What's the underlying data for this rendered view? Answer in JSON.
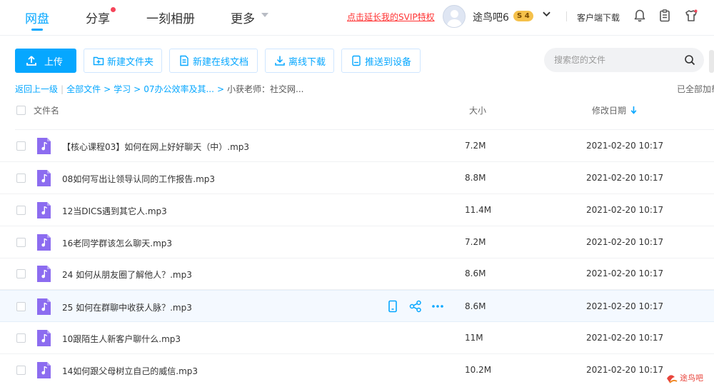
{
  "nav": {
    "tabs": [
      {
        "label": "网盘",
        "active": true
      },
      {
        "label": "分享",
        "badge_dot": true
      },
      {
        "label": "一刻相册"
      },
      {
        "label": "更多"
      }
    ],
    "svip_link": "点击延长我的SVIP特权",
    "username": "途鸟吧6",
    "vip_level": "4",
    "client_download": "客户端下载",
    "icons": [
      "notification-bell-icon",
      "clipboard-icon",
      "shirt-skin-icon"
    ]
  },
  "toolbar": {
    "upload": "上传",
    "new_folder": "新建文件夹",
    "new_online_doc": "新建在线文档",
    "offline_download": "离线下载",
    "push_to_device": "推送到设备",
    "search_placeholder": "搜索您的文件"
  },
  "breadcrumb": {
    "back": "返回上一级",
    "items": [
      "全部文件",
      "学习",
      "07办公效率及其..."
    ],
    "current": "小获老师：社交网...",
    "loaded_all": "已全部加载"
  },
  "table": {
    "headers": {
      "name": "文件名",
      "size": "大小",
      "modified": "修改日期"
    },
    "sort": "modified-desc",
    "rows": [
      {
        "name": "【核心课程03】如何在网上好好聊天（中）.mp3",
        "size": "7.2M",
        "modified": "2021-02-20 10:17"
      },
      {
        "name": "08如何写出让领导认同的工作报告.mp3",
        "size": "8.8M",
        "modified": "2021-02-20 10:17"
      },
      {
        "name": "12当DICS遇到其它人.mp3",
        "size": "11.4M",
        "modified": "2021-02-20 10:17"
      },
      {
        "name": "16老同学群该怎么聊天.mp3",
        "size": "7.2M",
        "modified": "2021-02-20 10:17"
      },
      {
        "name": "24 如何从朋友圈了解他人？.mp3",
        "size": "8.6M",
        "modified": "2021-02-20 10:17"
      },
      {
        "name": "25 如何在群聊中收获人脉？.mp3",
        "size": "8.6M",
        "modified": "2021-02-20 10:17",
        "hovered": true
      },
      {
        "name": "10跟陌生人新客户聊什么.mp3",
        "size": "11M",
        "modified": "2021-02-20 10:17"
      },
      {
        "name": "14如何跟父母树立自己的威信.mp3",
        "size": "10.2M",
        "modified": "2021-02-20 10:17"
      }
    ],
    "hover_actions": [
      "phone-icon",
      "share-icon",
      "more-icon"
    ]
  },
  "colors": {
    "accent": "#06a7ff",
    "file_icon": "#8c6cf0",
    "svip": "#ff3333"
  },
  "watermark": "途鸟吧"
}
